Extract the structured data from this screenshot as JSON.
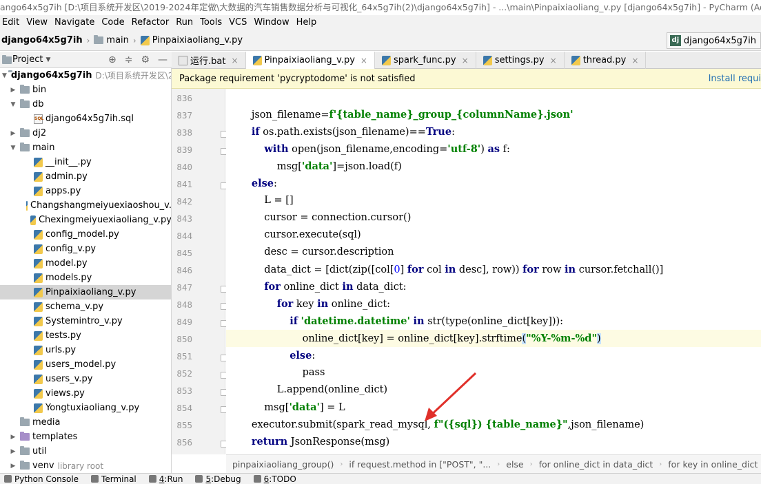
{
  "window": {
    "title": "ango64x5g7ih [D:\\项目系统开发区\\2019-2024年定做\\大数据的汽车销售数据分析与可视化_64x5g7ih(2)\\django64x5g7ih] - ...\\main\\Pinpaixiaoliang_v.py [django64x5g7ih] - PyCharm (Administrator)"
  },
  "menu": [
    "Edit",
    "View",
    "Navigate",
    "Code",
    "Refactor",
    "Run",
    "Tools",
    "VCS",
    "Window",
    "Help"
  ],
  "nav": {
    "project": "django64x5g7ih",
    "folder": "main",
    "file": "Pinpaixiaoliang_v.py",
    "run_config": "django64x5g7ih"
  },
  "project_panel": {
    "title": "Project",
    "root_name": "django64x5g7ih",
    "root_path": "D:\\项目系统开发区\\20"
  },
  "tree": [
    {
      "label": "bin",
      "kind": "folder",
      "arrow": "right",
      "indent": 1
    },
    {
      "label": "db",
      "kind": "folder",
      "arrow": "down",
      "indent": 1
    },
    {
      "label": "django64x5g7ih.sql",
      "kind": "sql",
      "arrow": "",
      "indent": 2
    },
    {
      "label": "dj2",
      "kind": "folder",
      "arrow": "right",
      "indent": 1
    },
    {
      "label": "main",
      "kind": "folder",
      "arrow": "down",
      "indent": 1
    },
    {
      "label": "__init__.py",
      "kind": "py",
      "arrow": "",
      "indent": 2
    },
    {
      "label": "admin.py",
      "kind": "py",
      "arrow": "",
      "indent": 2
    },
    {
      "label": "apps.py",
      "kind": "py",
      "arrow": "",
      "indent": 2
    },
    {
      "label": "Changshangmeiyuexiaoshou_v.",
      "kind": "py",
      "arrow": "",
      "indent": 2
    },
    {
      "label": "Chexingmeiyuexiaoliang_v.py",
      "kind": "py",
      "arrow": "",
      "indent": 2
    },
    {
      "label": "config_model.py",
      "kind": "py",
      "arrow": "",
      "indent": 2
    },
    {
      "label": "config_v.py",
      "kind": "py",
      "arrow": "",
      "indent": 2
    },
    {
      "label": "model.py",
      "kind": "py",
      "arrow": "",
      "indent": 2
    },
    {
      "label": "models.py",
      "kind": "py",
      "arrow": "",
      "indent": 2
    },
    {
      "label": "Pinpaixiaoliang_v.py",
      "kind": "py",
      "arrow": "",
      "indent": 2,
      "selected": true
    },
    {
      "label": "schema_v.py",
      "kind": "py",
      "arrow": "",
      "indent": 2
    },
    {
      "label": "Systemintro_v.py",
      "kind": "py",
      "arrow": "",
      "indent": 2
    },
    {
      "label": "tests.py",
      "kind": "py",
      "arrow": "",
      "indent": 2
    },
    {
      "label": "urls.py",
      "kind": "py",
      "arrow": "",
      "indent": 2
    },
    {
      "label": "users_model.py",
      "kind": "py",
      "arrow": "",
      "indent": 2
    },
    {
      "label": "users_v.py",
      "kind": "py",
      "arrow": "",
      "indent": 2
    },
    {
      "label": "views.py",
      "kind": "py",
      "arrow": "",
      "indent": 2
    },
    {
      "label": "Yongtuxiaoliang_v.py",
      "kind": "py",
      "arrow": "",
      "indent": 2
    },
    {
      "label": "media",
      "kind": "folder",
      "arrow": "",
      "indent": 1
    },
    {
      "label": "templates",
      "kind": "folder-purple",
      "arrow": "right",
      "indent": 1
    },
    {
      "label": "util",
      "kind": "folder",
      "arrow": "right",
      "indent": 1
    },
    {
      "label": "venv",
      "kind": "folder",
      "arrow": "right",
      "indent": 1,
      "suffix": "library root"
    }
  ],
  "tabs": [
    {
      "label": "运行.bat",
      "kind": "bat",
      "active": false
    },
    {
      "label": "Pinpaixiaoliang_v.py",
      "kind": "py",
      "active": true
    },
    {
      "label": "spark_func.py",
      "kind": "py",
      "active": false
    },
    {
      "label": "settings.py",
      "kind": "py",
      "active": false
    },
    {
      "label": "thread.py",
      "kind": "py",
      "active": false
    }
  ],
  "notice": {
    "message": "Package requirement 'pycryptodome' is not satisfied",
    "action": "Install requi"
  },
  "code": {
    "line_numbers": [
      "836",
      "837",
      "838",
      "839",
      "840",
      "841",
      "842",
      "843",
      "844",
      "845",
      "846",
      "847",
      "848",
      "849",
      "850",
      "851",
      "852",
      "853",
      "854",
      "855",
      "856"
    ],
    "lines": [
      "",
      "        json_filename=f'{table_name}_group_{columnName}.json'",
      "        if os.path.exists(json_filename)==True:",
      "            with open(json_filename,encoding='utf-8') as f:",
      "                msg['data']=json.load(f)",
      "        else:",
      "            L = []",
      "            cursor = connection.cursor()",
      "            cursor.execute(sql)",
      "            desc = cursor.description",
      "            data_dict = [dict(zip([col[0] for col in desc], row)) for row in cursor.fetchall()]",
      "            for online_dict in data_dict:",
      "                for key in online_dict:",
      "                    if 'datetime.datetime' in str(type(online_dict[key])):",
      "                        online_dict[key] = online_dict[key].strftime(\"%Y-%m-%d\")",
      "                    else:",
      "                        pass",
      "                L.append(online_dict)",
      "            msg['data'] = L",
      "        executor.submit(spark_read_mysql, f\"({sql}) {table_name}\",json_filename)",
      "        return JsonResponse(msg)"
    ]
  },
  "breadcrumbs": [
    "pinpaixiaoliang_group()",
    "if request.method in [\"POST\", \"...",
    "else",
    "for online_dict in data_dict",
    "for key in online_dict",
    "if 'da"
  ],
  "status": [
    {
      "label": "Python Console",
      "key": ""
    },
    {
      "label": "Terminal",
      "key": ""
    },
    {
      "label": "Run",
      "key": "4"
    },
    {
      "label": "Debug",
      "key": "5"
    },
    {
      "label": "TODO",
      "key": "6"
    }
  ]
}
